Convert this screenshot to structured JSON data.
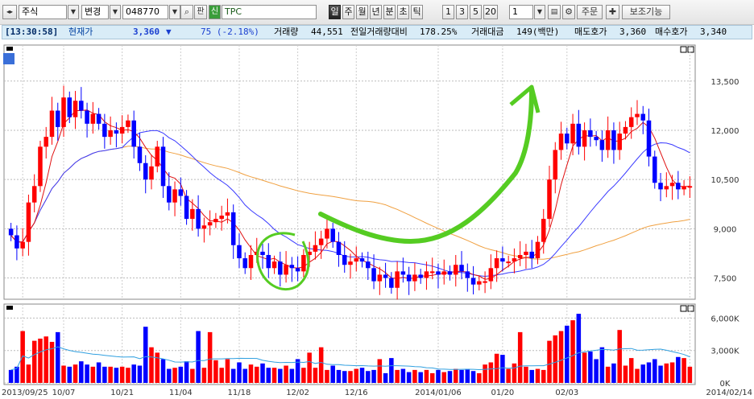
{
  "toolbar": {
    "market_select": "주식",
    "change_select": "변경",
    "code": "048770",
    "search_label": "판",
    "credit_badge": "신",
    "stock_name": "TPC",
    "periods": [
      "일",
      "주",
      "월",
      "년",
      "분",
      "초",
      "틱"
    ],
    "minute_values": [
      "1",
      "3",
      "5",
      "20"
    ],
    "count_value": "1",
    "order_button": "주문",
    "aux_button": "보조기능"
  },
  "quote": {
    "time": "[13:30:58]",
    "current_price_label": "현재가",
    "current_price": "3,360",
    "direction_arrow": "▼",
    "change": "75 (-2.18%)",
    "volume_label": "거래량",
    "volume": "44,551",
    "prev_volume_ratio_label": "전일거래량대비",
    "prev_volume_ratio": "178.25%",
    "trade_amount_label": "거래대금",
    "trade_amount": "149(백만)",
    "ask_label": "매도호가",
    "ask": "3,360",
    "bid_label": "매수호가",
    "bid": "3,340"
  },
  "chart_data": [
    {
      "type": "candlestick",
      "panel": "price",
      "y_axis_ticks": [
        "13,500",
        "12,000",
        "10,500",
        "9,000",
        "7,500"
      ],
      "ylim": [
        6900,
        14500
      ],
      "x_tick_labels": [
        "2013/09/25",
        "10/07",
        "10/21",
        "11/04",
        "11/18",
        "12/02",
        "12/16",
        "2014/01/06",
        "01/20",
        "02/03",
        "2014/02/14"
      ],
      "series": [
        {
          "kind": "close",
          "values": [
            8800,
            8400,
            8600,
            9800,
            10300,
            11500,
            11800,
            12600,
            12100,
            13000,
            12400,
            12900,
            12600,
            12200,
            12500,
            12200,
            11800,
            12000,
            11900,
            12100,
            12300,
            11500,
            11000,
            10500,
            10900,
            11500,
            10300,
            9800,
            10200,
            10000,
            9300,
            9600,
            9000,
            9100,
            9200,
            9300,
            9400,
            9500,
            8500,
            8100,
            7800,
            8200,
            8300,
            8200,
            7800,
            8000,
            7600,
            7900,
            7800,
            7700,
            8200,
            8300,
            8500,
            8700,
            9000,
            8600,
            8200,
            7900,
            8000,
            8100,
            8000,
            7800,
            7400,
            7600,
            7500,
            7200,
            7700,
            7600,
            7400,
            7600,
            7500,
            7700,
            7700,
            7600,
            7700,
            7600,
            7900,
            7700,
            7500,
            7300,
            7400,
            7400,
            7800,
            8100,
            8000,
            8000,
            8100,
            8200,
            8300,
            8100,
            8600,
            9300,
            10500,
            11400,
            11900,
            11600,
            12200,
            11500,
            12000,
            11800,
            11700,
            11400,
            12000,
            11400,
            11900,
            12100,
            12400,
            12500,
            12300,
            11200,
            10400,
            10200,
            10300,
            10400,
            10200,
            10300,
            10300
          ],
          "note": "daily closes approx"
        },
        {
          "kind": "ma5",
          "color": "#e01010"
        },
        {
          "kind": "ma20",
          "color": "#3a3aff"
        },
        {
          "kind": "ma60",
          "color": "#f0a040"
        }
      ]
    },
    {
      "type": "bar",
      "panel": "volume",
      "y_axis_ticks": [
        "6,000K",
        "3,000K",
        "0K"
      ],
      "ylim": [
        0,
        7000
      ],
      "values": [
        1200,
        1500,
        4800,
        1700,
        3900,
        4100,
        4300,
        3800,
        4700,
        1600,
        1500,
        1700,
        2000,
        1700,
        1500,
        1900,
        1500,
        1500,
        1400,
        1500,
        1400,
        1700,
        1600,
        5200,
        3300,
        2800,
        2200,
        1300,
        1400,
        1500,
        2000,
        1300,
        4800,
        1400,
        4700,
        2100,
        1400,
        2200,
        1300,
        1900,
        1300,
        1700,
        1500,
        1800,
        1400,
        1400,
        1300,
        1600,
        1300,
        2200,
        1400,
        2800,
        1400,
        3300,
        1200,
        1600,
        1200,
        1100,
        1100,
        1300,
        1400,
        1100,
        1200,
        2200,
        900,
        2300,
        1200,
        1300,
        1000,
        1200,
        1000,
        1200,
        900,
        1200,
        1000,
        1100,
        1300,
        1200,
        1300,
        1100,
        900,
        1700,
        1900,
        2700,
        2600,
        1300,
        1800,
        4700,
        1500,
        1200,
        1300,
        1200,
        3900,
        4400,
        4800,
        5300,
        5800,
        6400,
        2800,
        2900,
        2200,
        3300,
        1500,
        1800,
        4900,
        1600,
        2300,
        1300,
        1700,
        1900,
        2200,
        1600,
        1800,
        1900,
        2400,
        2300,
        1500
      ],
      "line_series": {
        "kind": "volume_ma",
        "color": "#30a0e0"
      }
    }
  ],
  "colors": {
    "up": "#ff0000",
    "down": "#0000ff",
    "annotation": "#55cc22"
  }
}
